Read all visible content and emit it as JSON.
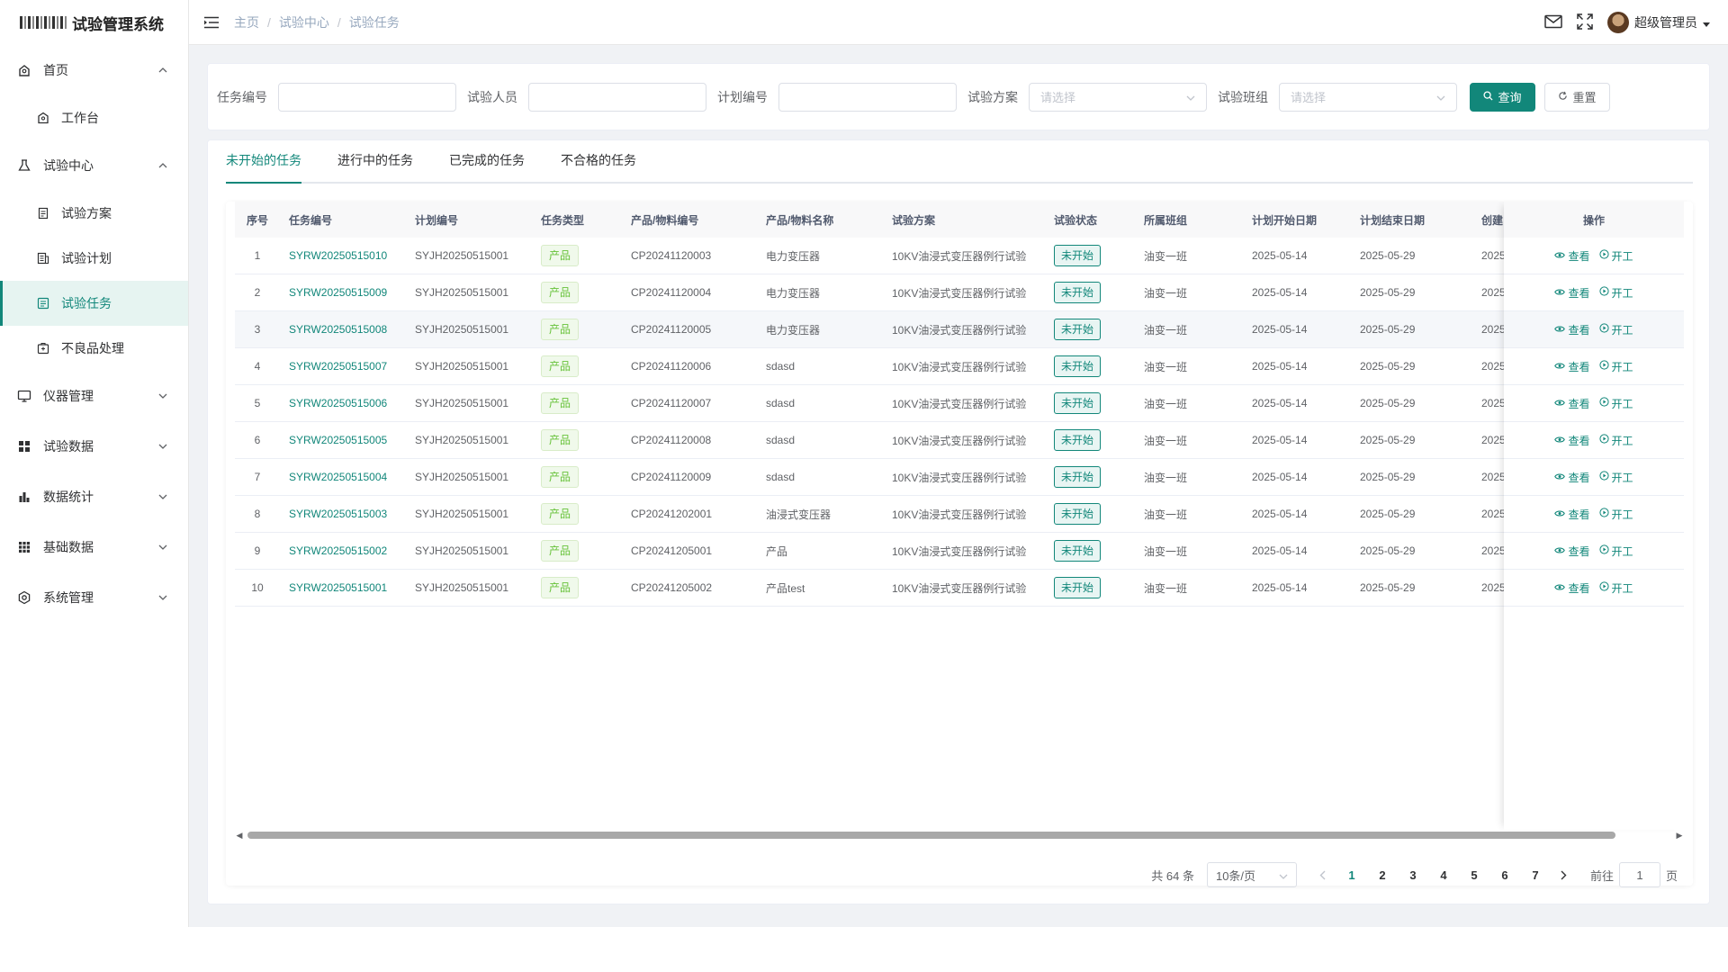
{
  "app": {
    "title": "试验管理系统"
  },
  "sidebar": {
    "items": [
      {
        "label": "首页",
        "icon": "home-icon",
        "expanded": true
      },
      {
        "label": "试验中心",
        "icon": "test-center-icon",
        "expanded": true
      },
      {
        "label": "仪器管理",
        "icon": "monitor-icon",
        "expanded": false
      },
      {
        "label": "试验数据",
        "icon": "grid-icon",
        "expanded": false
      },
      {
        "label": "数据统计",
        "icon": "bar-chart-icon",
        "expanded": false
      },
      {
        "label": "基础数据",
        "icon": "apps-icon",
        "expanded": false
      },
      {
        "label": "系统管理",
        "icon": "settings-icon",
        "expanded": false
      }
    ],
    "sub_home": [
      {
        "label": "工作台",
        "icon": "workbench-icon"
      }
    ],
    "sub_test": [
      {
        "label": "试验方案",
        "icon": "document-icon"
      },
      {
        "label": "试验计划",
        "icon": "plan-icon"
      },
      {
        "label": "试验任务",
        "icon": "task-icon",
        "active": true
      },
      {
        "label": "不良品处理",
        "icon": "defect-icon"
      }
    ]
  },
  "header": {
    "breadcrumb": [
      "主页",
      "试验中心",
      "试验任务"
    ],
    "user": "超级管理员"
  },
  "search": {
    "task_no_label": "任务编号",
    "tester_label": "试验人员",
    "plan_no_label": "计划编号",
    "scheme_label": "试验方案",
    "scheme_placeholder": "请选择",
    "team_label": "试验班组",
    "team_placeholder": "请选择",
    "query_btn": "查询",
    "reset_btn": "重置"
  },
  "tabs": [
    "未开始的任务",
    "进行中的任务",
    "已完成的任务",
    "不合格的任务"
  ],
  "table": {
    "columns": [
      "序号",
      "任务编号",
      "计划编号",
      "任务类型",
      "产品/物料编号",
      "产品/物料名称",
      "试验方案",
      "试验状态",
      "所属班组",
      "计划开始日期",
      "计划结束日期",
      "创建",
      "操作"
    ],
    "rows": [
      {
        "seq": "1",
        "task_no": "SYRW20250515010",
        "plan_no": "SYJH20250515001",
        "type": "产品",
        "code": "CP20241120003",
        "name": "电力变压器",
        "scheme": "10KV油浸式变压器例行试验",
        "status": "未开始",
        "team": "油变一班",
        "start": "2025-05-14",
        "end": "2025-05-29",
        "created": "2025-"
      },
      {
        "seq": "2",
        "task_no": "SYRW20250515009",
        "plan_no": "SYJH20250515001",
        "type": "产品",
        "code": "CP20241120004",
        "name": "电力变压器",
        "scheme": "10KV油浸式变压器例行试验",
        "status": "未开始",
        "team": "油变一班",
        "start": "2025-05-14",
        "end": "2025-05-29",
        "created": "2025-"
      },
      {
        "seq": "3",
        "task_no": "SYRW20250515008",
        "plan_no": "SYJH20250515001",
        "type": "产品",
        "code": "CP20241120005",
        "name": "电力变压器",
        "scheme": "10KV油浸式变压器例行试验",
        "status": "未开始",
        "team": "油变一班",
        "start": "2025-05-14",
        "end": "2025-05-29",
        "created": "2025-"
      },
      {
        "seq": "4",
        "task_no": "SYRW20250515007",
        "plan_no": "SYJH20250515001",
        "type": "产品",
        "code": "CP20241120006",
        "name": "sdasd",
        "scheme": "10KV油浸式变压器例行试验",
        "status": "未开始",
        "team": "油变一班",
        "start": "2025-05-14",
        "end": "2025-05-29",
        "created": "2025-"
      },
      {
        "seq": "5",
        "task_no": "SYRW20250515006",
        "plan_no": "SYJH20250515001",
        "type": "产品",
        "code": "CP20241120007",
        "name": "sdasd",
        "scheme": "10KV油浸式变压器例行试验",
        "status": "未开始",
        "team": "油变一班",
        "start": "2025-05-14",
        "end": "2025-05-29",
        "created": "2025-"
      },
      {
        "seq": "6",
        "task_no": "SYRW20250515005",
        "plan_no": "SYJH20250515001",
        "type": "产品",
        "code": "CP20241120008",
        "name": "sdasd",
        "scheme": "10KV油浸式变压器例行试验",
        "status": "未开始",
        "team": "油变一班",
        "start": "2025-05-14",
        "end": "2025-05-29",
        "created": "2025-"
      },
      {
        "seq": "7",
        "task_no": "SYRW20250515004",
        "plan_no": "SYJH20250515001",
        "type": "产品",
        "code": "CP20241120009",
        "name": "sdasd",
        "scheme": "10KV油浸式变压器例行试验",
        "status": "未开始",
        "team": "油变一班",
        "start": "2025-05-14",
        "end": "2025-05-29",
        "created": "2025-"
      },
      {
        "seq": "8",
        "task_no": "SYRW20250515003",
        "plan_no": "SYJH20250515001",
        "type": "产品",
        "code": "CP20241202001",
        "name": "油浸式变压器",
        "scheme": "10KV油浸式变压器例行试验",
        "status": "未开始",
        "team": "油变一班",
        "start": "2025-05-14",
        "end": "2025-05-29",
        "created": "2025-"
      },
      {
        "seq": "9",
        "task_no": "SYRW20250515002",
        "plan_no": "SYJH20250515001",
        "type": "产品",
        "code": "CP20241205001",
        "name": "产品",
        "scheme": "10KV油浸式变压器例行试验",
        "status": "未开始",
        "team": "油变一班",
        "start": "2025-05-14",
        "end": "2025-05-29",
        "created": "2025-"
      },
      {
        "seq": "10",
        "task_no": "SYRW20250515001",
        "plan_no": "SYJH20250515001",
        "type": "产品",
        "code": "CP20241205002",
        "name": "产品test",
        "scheme": "10KV油浸式变压器例行试验",
        "status": "未开始",
        "team": "油变一班",
        "start": "2025-05-14",
        "end": "2025-05-29",
        "created": "2025-"
      }
    ],
    "ops": {
      "view": "查看",
      "start": "开工"
    },
    "highlighted_row": 3
  },
  "pagination": {
    "total": "共 64 条",
    "page_size": "10条/页",
    "pages": [
      "1",
      "2",
      "3",
      "4",
      "5",
      "6",
      "7"
    ],
    "current": "1",
    "goto_label": "前往",
    "goto_value": "1",
    "page_unit": "页"
  },
  "colors": {
    "accent": "#12877a",
    "tag_green": "#67c23a"
  }
}
